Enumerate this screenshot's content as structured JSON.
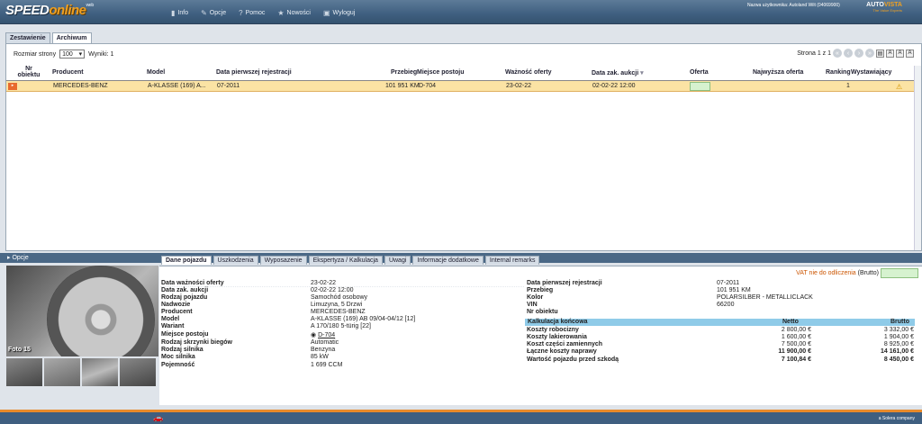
{
  "header": {
    "logo_speed": "SPEED",
    "logo_online": "online",
    "logo_sup": "web",
    "nav": [
      {
        "label": "Info",
        "icon": "info-icon",
        "glyph": "▮"
      },
      {
        "label": "Opcje",
        "icon": "wrench-icon",
        "glyph": "✎"
      },
      {
        "label": "Pomoc",
        "icon": "help-icon",
        "glyph": "?"
      },
      {
        "label": "Nowości",
        "icon": "star-icon",
        "glyph": "★"
      },
      {
        "label": "Wyloguj",
        "icon": "logout-icon",
        "glyph": "▣"
      }
    ],
    "user_info": "Nazwa użytkownika: Autoland Wilt (04069900)",
    "brand_auto": "AUTO",
    "brand_vista": "VISTA",
    "brand_tagline": "The Value Experts"
  },
  "tabs": [
    {
      "label": "Zestawienie",
      "active": false
    },
    {
      "label": "Archiwum",
      "active": true
    }
  ],
  "toolbar": {
    "page_size_label": "Rozmiar strony",
    "page_size_value": "100",
    "results_label": "Wyniki: 1",
    "page_label": "Strona 1 z 1"
  },
  "grid": {
    "columns": [
      {
        "label": "Nr obiektu"
      },
      {
        "label": "Producent"
      },
      {
        "label": "Model"
      },
      {
        "label": "Data pierwszej rejestracji"
      },
      {
        "label": "Przebieg"
      },
      {
        "label": "Miejsce postoju"
      },
      {
        "label": "Ważność oferty"
      },
      {
        "label": "Data zak. aukcji"
      },
      {
        "label": "Oferta"
      },
      {
        "label": "Najwyższa oferta"
      },
      {
        "label": "Ranking"
      },
      {
        "label": "Wystawiający"
      }
    ],
    "row": {
      "flag": "▸",
      "producent": "MERCEDES-BENZ",
      "model": "A-KLASSE (169) A...",
      "first_reg": "07-2011",
      "przebieg": "101 951 KM",
      "miejsce": "D-704",
      "waznosc": "23-02-22",
      "data_aukcji": "02-02-22 12:00",
      "ranking": "1"
    }
  },
  "opcje_label": "Opcje",
  "photo": {
    "label": "Foto 15"
  },
  "detail_tabs": [
    {
      "label": "Dane pojazdu",
      "active": true
    },
    {
      "label": "Uszkodzenia",
      "active": false
    },
    {
      "label": "Wyposazenie",
      "active": false
    },
    {
      "label": "Ekspertyza / Kalkulacja",
      "active": false
    },
    {
      "label": "Uwagi",
      "active": false
    },
    {
      "label": "Informacje dodatkowe",
      "active": false
    },
    {
      "label": "Internal remarks",
      "active": false
    }
  ],
  "vat": {
    "text": "VAT nie do odliczenia",
    "suffix": "(Brutto)"
  },
  "left_fields": [
    {
      "label": "Data ważności oferty",
      "value": "23-02-22"
    },
    {
      "label": "Data zak. aukcji",
      "value": "02-02-22 12:00"
    },
    {
      "label": "Rodzaj pojazdu",
      "value": "Samochód osobowy"
    },
    {
      "label": "Nadwozie",
      "value": "Limuzyna, 5 Drzwi"
    },
    {
      "label": "Producent",
      "value": "MERCEDES-BENZ"
    },
    {
      "label": "Model",
      "value": "A-KLASSE (169) AB 09/04-04/12 [12]"
    },
    {
      "label": "Wariant",
      "value": "A 170/180 5-türig [22]"
    },
    {
      "label": "Miejsce postoju",
      "value": "D-704"
    },
    {
      "label": "Rodzaj skrzynki biegów",
      "value": "Automatic"
    },
    {
      "label": "Rodzaj silnika",
      "value": "Benzyna"
    },
    {
      "label": "Moc silnika",
      "value": "85 kW"
    },
    {
      "label": "Pojemność",
      "value": "1 699 CCM"
    }
  ],
  "right_fields": [
    {
      "label": "Data pierwszej rejestracji",
      "value": "07-2011"
    },
    {
      "label": "Przebieg",
      "value": "101 951 KM"
    },
    {
      "label": "Kolor",
      "value": "POLARSILBER - METALLICLACK"
    },
    {
      "label": "VIN",
      "value": "66200"
    },
    {
      "label": "Nr obiektu",
      "value": ""
    }
  ],
  "calc": {
    "title": "Kalkulacja końcowa",
    "netto": "Netto",
    "brutto": "Brutto",
    "rows": [
      {
        "label": "Koszty robocizny",
        "netto": "2 800,00 €",
        "brutto": "3 332,00 €"
      },
      {
        "label": "Koszty lakierowania",
        "netto": "1 600,00 €",
        "brutto": "1 904,00 €"
      },
      {
        "label": "Koszt części zamiennych",
        "netto": "7 500,00 €",
        "brutto": "8 925,00 €"
      },
      {
        "label": "Łączne koszty naprawy",
        "netto": "11 900,00 €",
        "brutto": "14 161,00 €"
      },
      {
        "label": "Wartość pojazdu przed szkodą",
        "netto": "7 100,84 €",
        "brutto": "8 450,00 €"
      }
    ]
  },
  "footer": {
    "company": "a Solera company"
  },
  "colors": {
    "header": "#3f5f80",
    "accent": "#f0a020",
    "selected_row": "#fbe3a4",
    "calc_header": "#8fcbe8"
  }
}
